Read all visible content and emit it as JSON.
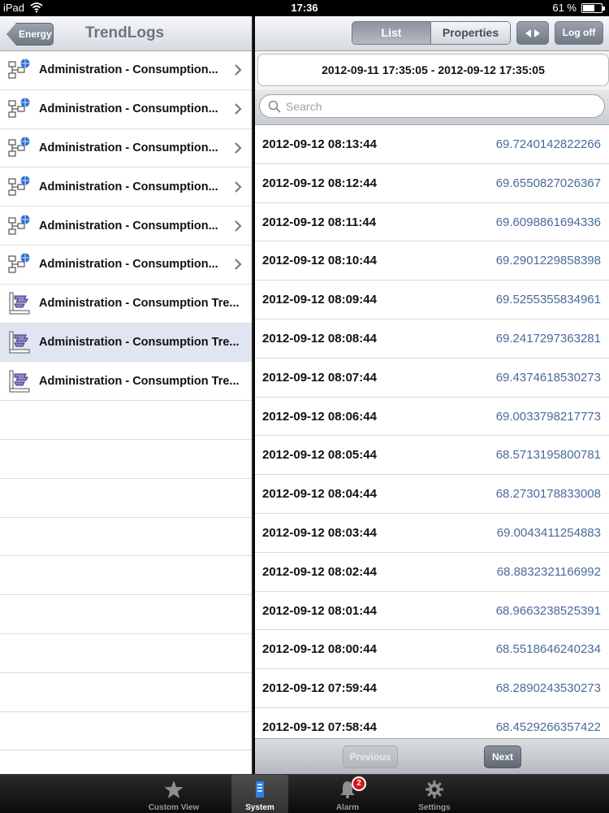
{
  "status_bar": {
    "carrier": "iPad",
    "time": "17:36",
    "battery": "61 %"
  },
  "left_pane": {
    "back_label": "Energy",
    "title": "TrendLogs",
    "items": [
      {
        "label": "Administration - Consumption...",
        "icon": "network-globe-icon",
        "chevron": true,
        "selected": false
      },
      {
        "label": "Administration - Consumption...",
        "icon": "network-globe-icon",
        "chevron": true,
        "selected": false
      },
      {
        "label": "Administration - Consumption...",
        "icon": "network-globe-icon",
        "chevron": true,
        "selected": false
      },
      {
        "label": "Administration - Consumption...",
        "icon": "network-globe-icon",
        "chevron": true,
        "selected": false
      },
      {
        "label": "Administration - Consumption...",
        "icon": "network-globe-icon",
        "chevron": true,
        "selected": false
      },
      {
        "label": "Administration - Consumption...",
        "icon": "network-globe-icon",
        "chevron": true,
        "selected": false
      },
      {
        "label": "Administration - Consumption Tre...",
        "icon": "trend-log-icon",
        "chevron": false,
        "selected": false
      },
      {
        "label": "Administration - Consumption Tre...",
        "icon": "trend-log-icon",
        "chevron": false,
        "selected": true
      },
      {
        "label": "Administration - Consumption Tre...",
        "icon": "trend-log-icon",
        "chevron": false,
        "selected": false
      }
    ]
  },
  "right_pane": {
    "tabs": {
      "list": "List",
      "properties": "Properties"
    },
    "log_off_label": "Log off",
    "date_range": "2012-09-11 17:35:05 - 2012-09-12 17:35:05",
    "search_placeholder": "Search",
    "records": [
      {
        "timestamp": "2012-09-12 08:13:44",
        "value": "69.7240142822266"
      },
      {
        "timestamp": "2012-09-12 08:12:44",
        "value": "69.6550827026367"
      },
      {
        "timestamp": "2012-09-12 08:11:44",
        "value": "69.6098861694336"
      },
      {
        "timestamp": "2012-09-12 08:10:44",
        "value": "69.2901229858398"
      },
      {
        "timestamp": "2012-09-12 08:09:44",
        "value": "69.5255355834961"
      },
      {
        "timestamp": "2012-09-12 08:08:44",
        "value": "69.2417297363281"
      },
      {
        "timestamp": "2012-09-12 08:07:44",
        "value": "69.4374618530273"
      },
      {
        "timestamp": "2012-09-12 08:06:44",
        "value": "69.0033798217773"
      },
      {
        "timestamp": "2012-09-12 08:05:44",
        "value": "68.5713195800781"
      },
      {
        "timestamp": "2012-09-12 08:04:44",
        "value": "68.2730178833008"
      },
      {
        "timestamp": "2012-09-12 08:03:44",
        "value": "69.0043411254883"
      },
      {
        "timestamp": "2012-09-12 08:02:44",
        "value": "68.8832321166992"
      },
      {
        "timestamp": "2012-09-12 08:01:44",
        "value": "68.9663238525391"
      },
      {
        "timestamp": "2012-09-12 08:00:44",
        "value": "68.5518646240234"
      },
      {
        "timestamp": "2012-09-12 07:59:44",
        "value": "68.2890243530273"
      },
      {
        "timestamp": "2012-09-12 07:58:44",
        "value": "68.4529266357422"
      }
    ],
    "pager": {
      "previous": "Previous",
      "next": "Next"
    }
  },
  "tab_bar": {
    "tabs": [
      {
        "label": "Custom View",
        "icon": "star-icon"
      },
      {
        "label": "System",
        "icon": "system-icon",
        "active": true
      },
      {
        "label": "Alarm",
        "icon": "bell-icon",
        "badge": "2"
      },
      {
        "label": "Settings",
        "icon": "gear-icon"
      }
    ]
  },
  "colors": {
    "value_text": "#4a6a9a",
    "selected_row": "#dfe5f1",
    "badge": "#d4151b"
  }
}
